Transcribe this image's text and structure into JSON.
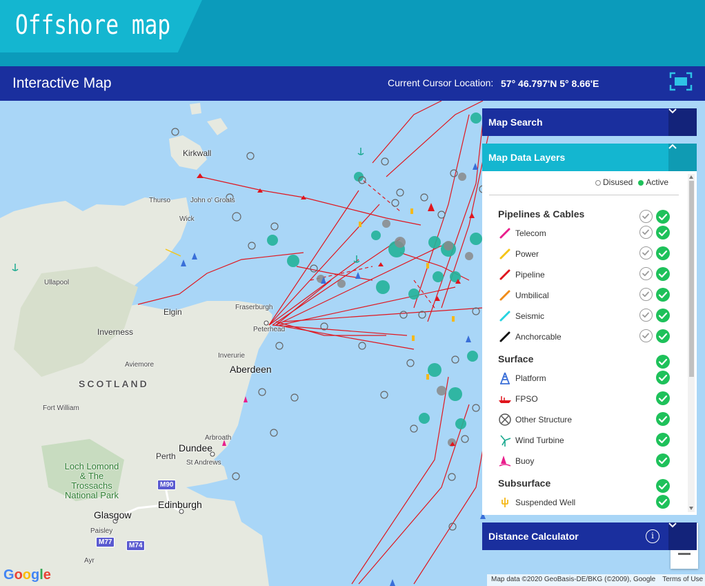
{
  "header": {
    "brand_title": "Offshore map"
  },
  "topbar": {
    "title": "Interactive Map",
    "cursor_label": "Current Cursor Location:",
    "cursor_value": "57° 46.797'N 5° 8.66'E",
    "fullscreen_icon": "fullscreen-icon"
  },
  "map": {
    "places": {
      "kirkwall": "Kirkwall",
      "thurso": "Thurso",
      "john_o_groats": "John o' Groats",
      "wick": "Wick",
      "ullapool": "Ullapool",
      "elgin": "Elgin",
      "inverness": "Inverness",
      "fraserburgh": "Fraserburgh",
      "peterhead": "Peterhead",
      "inverurie": "Inverurie",
      "aviemore": "Aviemore",
      "aberdeen": "Aberdeen",
      "scotland": "SCOTLAND",
      "fort_william": "Fort William",
      "arbroath": "Arbroath",
      "dundee": "Dundee",
      "perth": "Perth",
      "st_andrews": "St Andrews",
      "loch_lomond": "Loch Lomond & The Trossachs National Park",
      "edinburgh": "Edinburgh",
      "glasgow": "Glasgow",
      "paisley": "Paisley",
      "ayr": "Ayr"
    },
    "roads": {
      "m90": "M90",
      "m77": "M77",
      "m74": "M74"
    },
    "google_logo": "Google",
    "attribution": "Map data ©2020 GeoBasis-DE/BKG (©2009), Google",
    "terms": "Terms of Use"
  },
  "panels": {
    "map_search": {
      "title": "Map Search",
      "icon": "chevron-down-icon"
    },
    "map_data_layers": {
      "title": "Map Data Layers",
      "icon": "chevron-up-icon",
      "legend_disused": "Disused",
      "legend_active": "Active",
      "sections": {
        "pipelines": {
          "name": "Pipelines & Cables",
          "items": [
            {
              "label": "Telecom",
              "color": "#e91e8c"
            },
            {
              "label": "Power",
              "color": "#f5c518"
            },
            {
              "label": "Pipeline",
              "color": "#e0161e"
            },
            {
              "label": "Umbilical",
              "color": "#f08c1a"
            },
            {
              "label": "Seismic",
              "color": "#27d3e0"
            },
            {
              "label": "Anchorcable",
              "color": "#111111"
            }
          ]
        },
        "surface": {
          "name": "Surface",
          "items": [
            {
              "label": "Platform",
              "icon": "platform-icon"
            },
            {
              "label": "FPSO",
              "icon": "fpso-icon"
            },
            {
              "label": "Other Structure",
              "icon": "other-structure-icon"
            },
            {
              "label": "Wind Turbine",
              "icon": "wind-turbine-icon"
            },
            {
              "label": "Buoy",
              "icon": "buoy-icon"
            }
          ]
        },
        "subsurface": {
          "name": "Subsurface",
          "items": [
            {
              "label": "Suspended Well",
              "icon": "suspended-well-icon"
            }
          ]
        }
      }
    },
    "distance_calculator": {
      "title": "Distance Calculator",
      "info_icon": "i"
    }
  },
  "colors": {
    "header_teal": "#0b9bbb",
    "brand_teal": "#14b6d0",
    "navy": "#1a2f9e",
    "active_green": "#1ec15a",
    "sea": "#a9d6f7",
    "pipeline_red": "#e0161e"
  }
}
